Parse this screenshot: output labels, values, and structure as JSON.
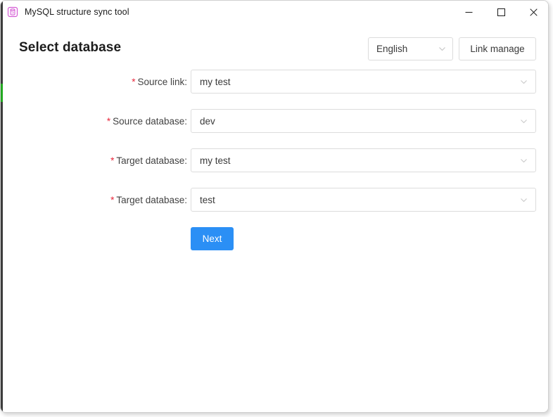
{
  "window": {
    "title": "MySQL structure sync tool",
    "icon": "database-s-icon",
    "icon_color": "#d45ad4",
    "controls": {
      "minimize": "minimize-icon",
      "maximize": "maximize-icon",
      "close": "close-icon"
    }
  },
  "header": {
    "page_title": "Select database",
    "language_select": {
      "value": "English",
      "chevron": "chevron-down-icon"
    },
    "link_manage_label": "Link manage"
  },
  "form": {
    "required_marker": "*",
    "rows": [
      {
        "label": "Source link:",
        "value": "my test",
        "required": true,
        "chevron": "chevron-down-icon"
      },
      {
        "label": "Source database:",
        "value": "dev",
        "required": true,
        "chevron": "chevron-down-icon"
      },
      {
        "label": "Target database:",
        "value": "my test",
        "required": true,
        "chevron": "chevron-down-icon"
      },
      {
        "label": "Target database:",
        "value": "test",
        "required": true,
        "chevron": "chevron-down-icon"
      }
    ],
    "submit_label": "Next"
  },
  "colors": {
    "accent_blue": "#2b8ff5",
    "required_red": "#e8273b",
    "icon_pink": "#d45ad4",
    "border_gray": "#dcdcdc",
    "status_green": "#22a81f"
  }
}
